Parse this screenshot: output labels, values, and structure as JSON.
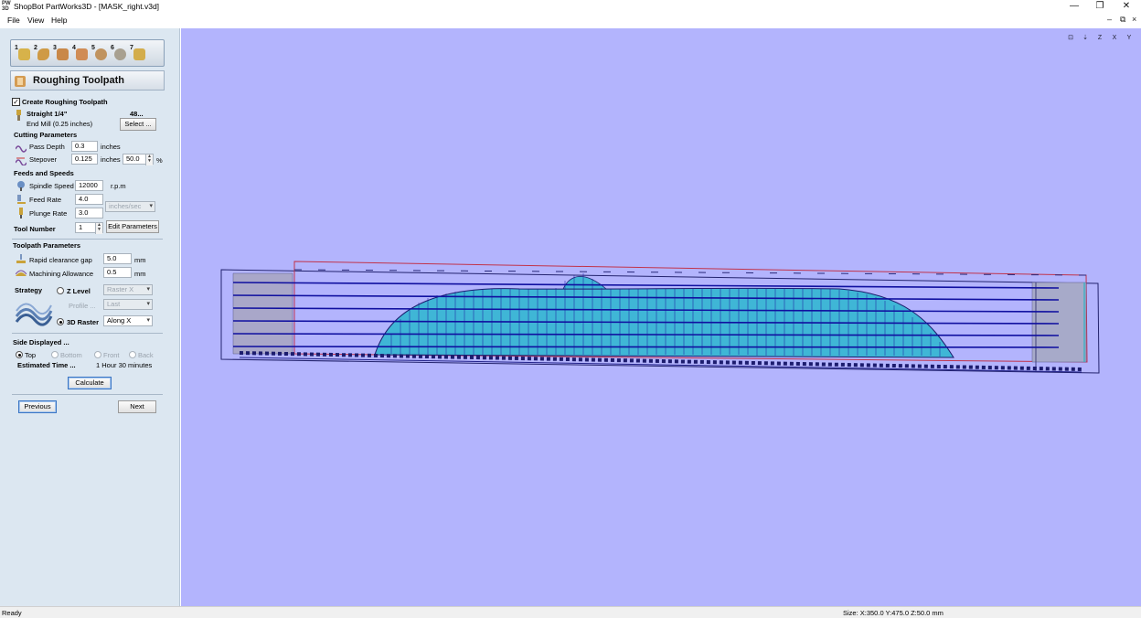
{
  "window": {
    "title": "ShopBot PartWorks3D - [MASK_right.v3d]",
    "app_icon_text": "PW 3D",
    "minimize_glyph": "—",
    "restore_glyph": "❐",
    "close_glyph": "✕"
  },
  "menu": {
    "file": "File",
    "view": "View",
    "help": "Help",
    "mdi_min": "–",
    "mdi_restore": "⧉",
    "mdi_close": "×"
  },
  "steps": [
    {
      "num": "1",
      "icon": "model-icon",
      "color": "#c9a23a"
    },
    {
      "num": "2",
      "icon": "position-icon",
      "color": "#c98f3a"
    },
    {
      "num": "3",
      "icon": "roughing-icon",
      "color": "#c97a3a"
    },
    {
      "num": "4",
      "icon": "finishing-icon",
      "color": "#c9803a"
    },
    {
      "num": "5",
      "icon": "cutout-icon",
      "color": "#b98a4a"
    },
    {
      "num": "6",
      "icon": "preview-icon",
      "color": "#a89a7a"
    },
    {
      "num": "7",
      "icon": "save-toolpath-icon",
      "color": "#c9a23a"
    }
  ],
  "section": {
    "step_number": "3",
    "title": "Roughing Toolpath"
  },
  "create_roughing": {
    "checked": true,
    "label": "Create Roughing Toolpath"
  },
  "tool": {
    "name": "Straight 1/4\"",
    "number_text": "48...",
    "description": "End Mill (0.25 inches)",
    "select_label": "Select ..."
  },
  "cutting": {
    "header": "Cutting Parameters",
    "pass_depth_label": "Pass Depth",
    "pass_depth": "0.3",
    "pass_depth_unit": "inches",
    "stepover_label": "Stepover",
    "stepover": "0.125",
    "stepover_unit": "inches",
    "stepover_percent": "50.0",
    "percent_sign": "%"
  },
  "feeds": {
    "header": "Feeds and Speeds",
    "spindle_label": "Spindle Speed",
    "spindle": "12000",
    "spindle_unit": "r.p.m",
    "feed_label": "Feed Rate",
    "feed": "4.0",
    "plunge_label": "Plunge Rate",
    "plunge": "3.0",
    "rate_unit": "inches/sec"
  },
  "tool_number": {
    "label": "Tool Number",
    "value": "1",
    "edit_label": "Edit Parameters"
  },
  "toolpath_params": {
    "header": "Toolpath Parameters",
    "rapid_label": "Rapid clearance gap",
    "rapid": "5.0",
    "rapid_unit": "mm",
    "allowance_label": "Machining Allowance",
    "allowance": "0.5",
    "allowance_unit": "mm"
  },
  "strategy": {
    "label": "Strategy",
    "zlevel_label": "Z Level",
    "zlevel_combo": "Raster X",
    "profile_label": "Profile ...",
    "profile_combo": "Last",
    "raster_label": "3D Raster",
    "raster_combo": "Along X",
    "selected": "3D Raster"
  },
  "side_displayed": {
    "header": "Side Displayed ...",
    "options": [
      "Top",
      "Bottom",
      "Front",
      "Back"
    ],
    "selected": "Top",
    "estimated_label": "Estimated Time ...",
    "estimated_value": "1 Hour 30 minutes"
  },
  "buttons": {
    "calculate": "Calculate",
    "previous": "Previous",
    "next": "Next"
  },
  "view_tools": [
    {
      "icon": "zoom-extents-icon",
      "glyph": "⊡"
    },
    {
      "icon": "iso-view-icon",
      "glyph": "⇣"
    },
    {
      "icon": "view-z-icon",
      "glyph": "Z"
    },
    {
      "icon": "view-x-icon",
      "glyph": "X"
    },
    {
      "icon": "view-y-icon",
      "glyph": "Y"
    }
  ],
  "status": {
    "left": "Ready",
    "right": "Size: X:350.0 Y:475.0 Z:50.0 mm"
  },
  "colors": {
    "viewport_bg": "#b3b4fd",
    "panel_bg": "#dce7f1",
    "toolpath": "#1a1aa8",
    "model_fill": "#3fb6d6"
  }
}
